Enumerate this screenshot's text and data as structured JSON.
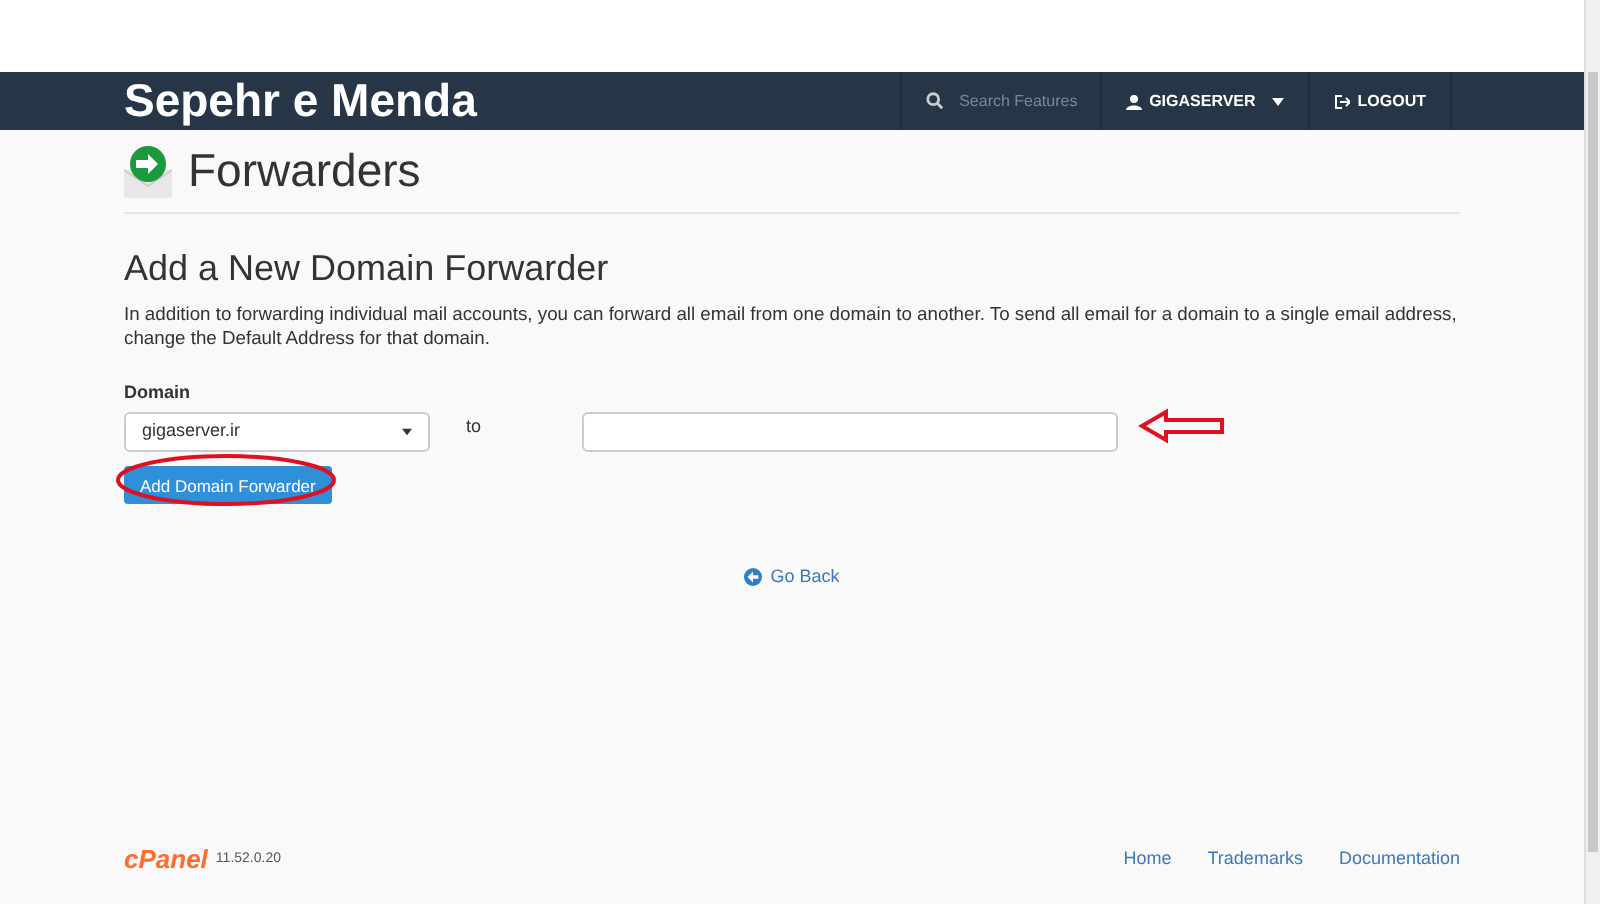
{
  "header": {
    "brand": "Sepehr e Menda",
    "search": {
      "placeholder": "Search Features"
    },
    "user": "GIGASERVER",
    "logout": "LOGOUT"
  },
  "page": {
    "title": "Forwarders"
  },
  "section": {
    "heading": "Add a New Domain Forwarder",
    "description": "In addition to forwarding individual mail accounts, you can forward all email from one domain to another. To send all email for a domain to a single email address, change the Default Address for that domain."
  },
  "form": {
    "domain_label": "Domain",
    "domain_value": "gigaserver.ir",
    "to_label": "to",
    "submit": "Add Domain Forwarder"
  },
  "go_back": "Go Back",
  "footer": {
    "logo": "cPanel",
    "version": "11.52.0.20",
    "links": [
      "Home",
      "Trademarks",
      "Documentation"
    ]
  }
}
